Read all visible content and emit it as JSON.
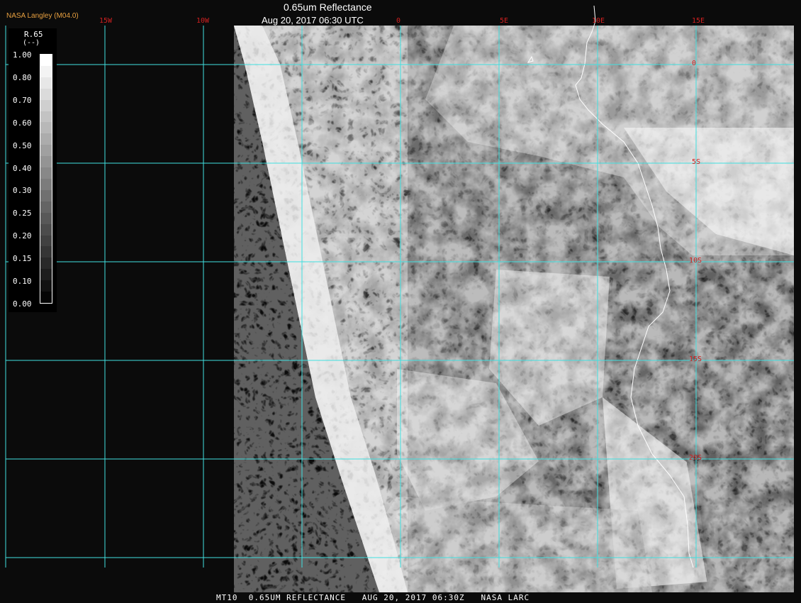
{
  "header": {
    "brand": "NASA Langley (M04.0)",
    "title": "0.65um Reflectance",
    "subtitle": "Aug 20, 2017 06:30 UTC"
  },
  "footer": {
    "text": "MT10  0.65UM REFLECTANCE   AUG 20, 2017 06:30Z   NASA LARC"
  },
  "legend": {
    "variable": "R.65",
    "unit": "(--)",
    "ticks": [
      "1.00",
      "0.80",
      "0.70",
      "0.60",
      "0.50",
      "0.40",
      "0.30",
      "0.25",
      "0.20",
      "0.15",
      "0.10",
      "0.00"
    ]
  },
  "map": {
    "longitude_labels": [
      "15W",
      "10W",
      "0",
      "5E",
      "10E",
      "15E"
    ],
    "latitude_labels": [
      "0",
      "5S",
      "10S",
      "15S",
      "20S"
    ],
    "grid_color": "#40e0e0",
    "label_color": "#d02020",
    "coastline_color": "#ffffff"
  }
}
